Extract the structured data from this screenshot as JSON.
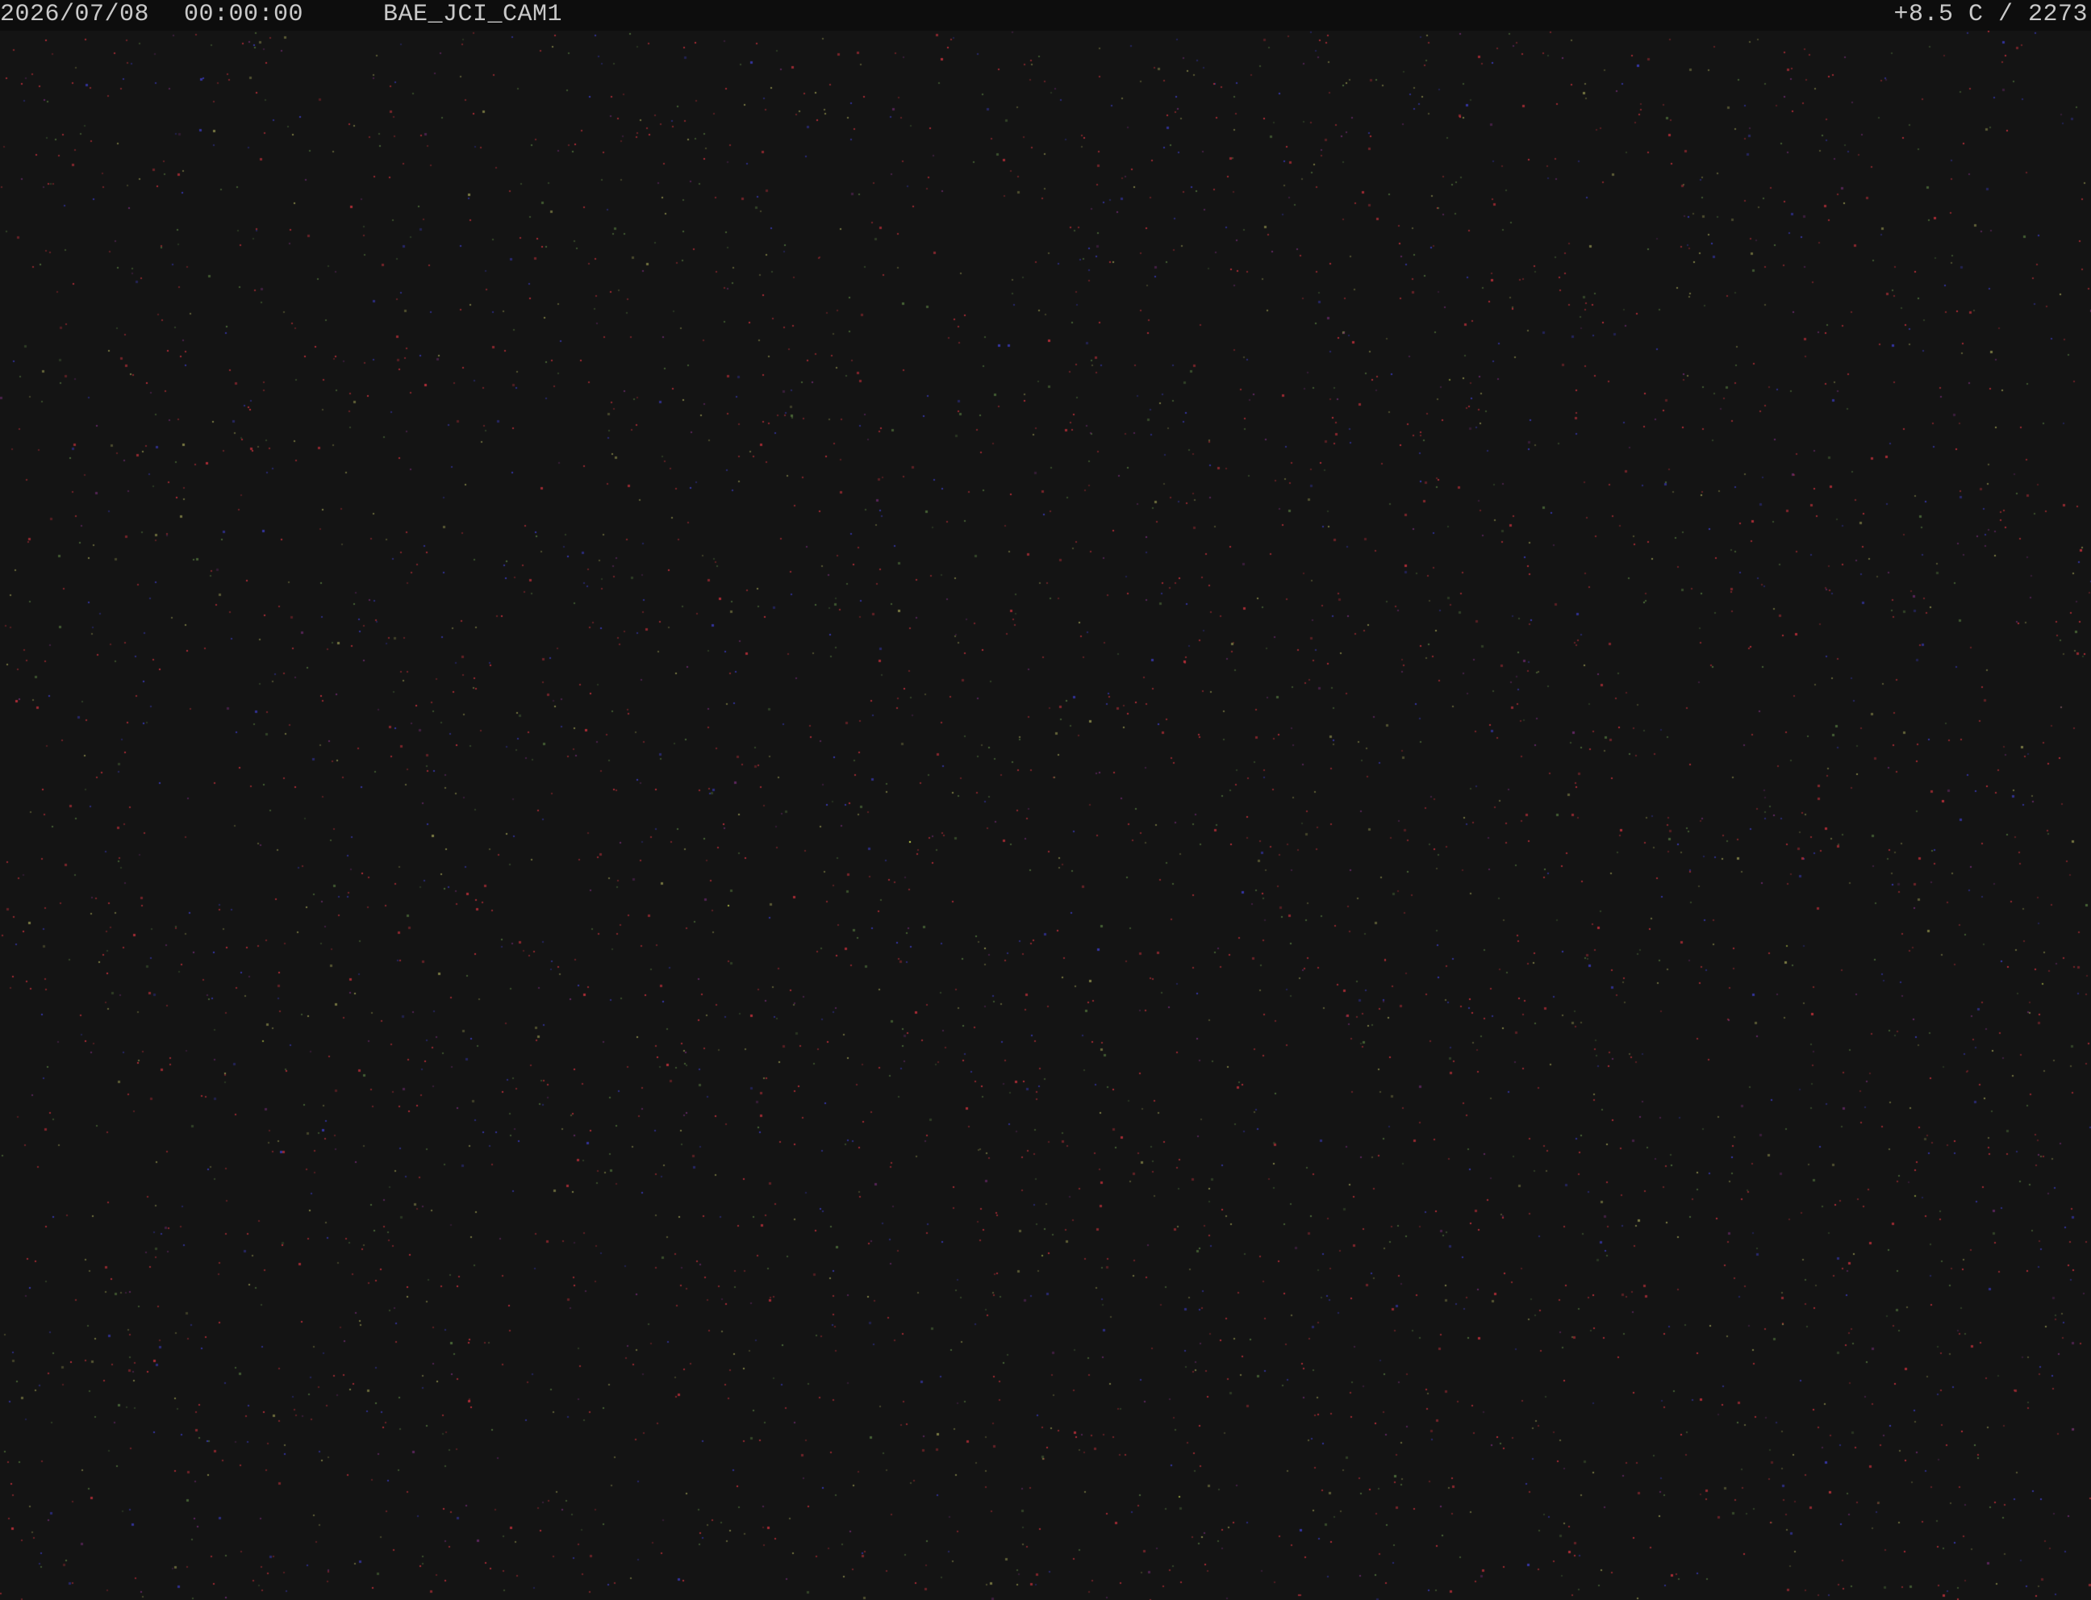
{
  "overlay": {
    "date": "2026/07/08",
    "time": "00:00:00",
    "camera_name": "BAE_JCI_CAM1",
    "sensor_readout": "+8.5 C / 2273"
  },
  "scene": {
    "description_kind": "night-sky-webcam-frame",
    "background_color": "#141414",
    "overlay_bar_color": "#0d0d0d",
    "overlay_text_color": "#c9c9c9",
    "noise_colors": [
      "#c0303a",
      "#3a3ab8",
      "#4f6f3a",
      "#8a8a4a",
      "#6a2a6a",
      "#ddee55"
    ]
  }
}
